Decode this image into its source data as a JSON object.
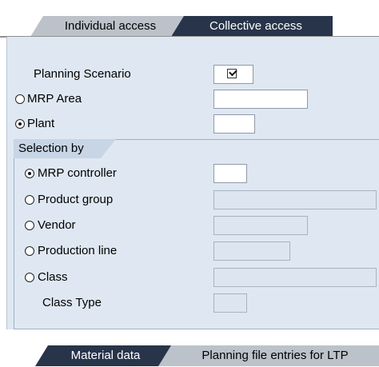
{
  "tabs": {
    "individual": "Individual access",
    "collective": "Collective access"
  },
  "fields": {
    "planning_scenario": "Planning Scenario",
    "mrp_area": "MRP Area",
    "plant": "Plant"
  },
  "selection": {
    "title": "Selection by",
    "mrp_controller": "MRP controller",
    "product_group": "Product group",
    "vendor": "Vendor",
    "production_line": "Production line",
    "class": "Class",
    "class_type": "Class Type"
  },
  "bottom_tabs": {
    "material": "Material data",
    "planning": "Planning file entries for LTP"
  },
  "colors": {
    "active_tab": "#27344a",
    "inactive_tab": "#bcc2c9",
    "panel_bg": "#dfe8f2"
  }
}
